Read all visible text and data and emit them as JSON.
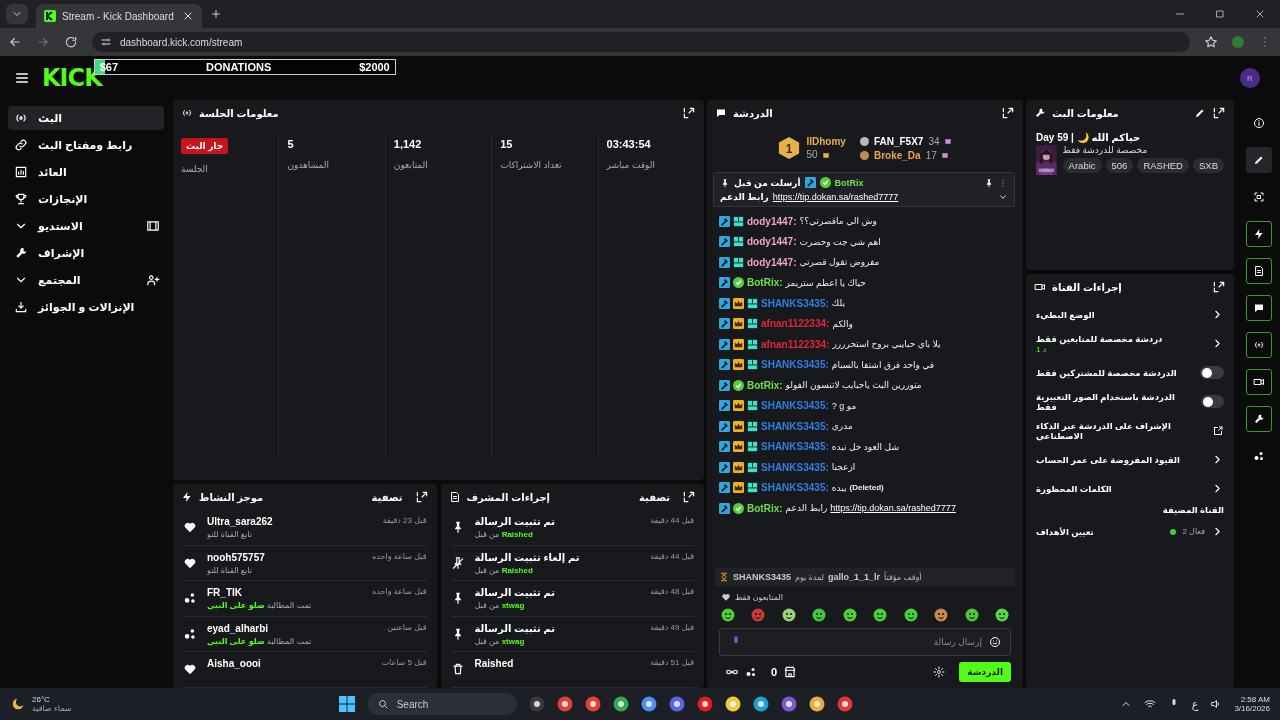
{
  "browser": {
    "tab_title": "Stream - Kick Dashboard",
    "url": "dashboard.kick.com/stream"
  },
  "header": {
    "logo": "KICK",
    "donation": {
      "current": "$67",
      "label": "DONATIONS",
      "goal": "$2000",
      "level": 0.034
    },
    "avatar": "R"
  },
  "sidebar": {
    "items": [
      {
        "kind": "link",
        "label": "البث",
        "selected": true
      },
      {
        "kind": "link",
        "label": "رابط ومفتاح البث",
        "selected": false
      },
      {
        "kind": "link",
        "label": "العائد",
        "selected": false
      },
      {
        "kind": "link",
        "label": "الإنجازات",
        "selected": false
      },
      {
        "kind": "group",
        "label": "الاستديو",
        "selected": false
      },
      {
        "kind": "link",
        "label": "الإشراف",
        "selected": false
      },
      {
        "kind": "group",
        "label": "المجتمع",
        "selected": false
      },
      {
        "kind": "link",
        "label": "الإنزالات و الجوائز",
        "selected": false
      }
    ]
  },
  "session": {
    "title": "معلومات الجلسة",
    "stats": [
      {
        "value": "03:43:54",
        "label": "الوقت مباشر"
      },
      {
        "value": "15",
        "label": "تعداد الاشتراكات"
      },
      {
        "value": "1,142",
        "label": "المتابعون"
      },
      {
        "value": "5",
        "label": "المشاهدون"
      }
    ],
    "status": "جار البث",
    "status_label": "الجلسة"
  },
  "activity": {
    "title": "موجز النشاط",
    "filter": "تصفية",
    "items": [
      {
        "kind": "follow",
        "user": "Ultra_sara262",
        "detail": "تابع القناة للتو",
        "time": "قبل 23 دقيقة"
      },
      {
        "kind": "follow",
        "user": "nooh575757",
        "detail": "تابع القناة للتو",
        "time": "قبل ساعة واحده"
      },
      {
        "kind": "redeem",
        "user": "FR_TIK",
        "detail": "تمت المطالبة **صلو على النبي**",
        "time": "قبل ساعة واحده"
      },
      {
        "kind": "redeem",
        "user": "eyad_alharbi",
        "detail": "تمت المطالبة **صلو على النبي**",
        "time": "قبل ساعتين"
      },
      {
        "kind": "follow",
        "user": "Aisha_oooi",
        "time": "قبل 5 ساعات"
      }
    ]
  },
  "mod_actions": {
    "title": "إجراءات المشرف",
    "filter": "تصفية",
    "items": [
      {
        "kind": "pin",
        "action": "تم تثبيت الرسالة",
        "by": "من قبل",
        "user": "Raished",
        "time": "قبل 44 دقيقة"
      },
      {
        "kind": "unpin",
        "action": "تم إلغاء تثبيت الرسالة",
        "by": "من قبل",
        "user": "Raished",
        "time": "قبل 44 دقيقة"
      },
      {
        "kind": "pin",
        "action": "تم تثبيت الرسالة",
        "by": "من قبل",
        "user": "xtwag",
        "time": "قبل 48 دقيقة"
      },
      {
        "kind": "pin",
        "action": "تم تثبيت الرسالة",
        "by": "من قبل",
        "user": "xtwag",
        "time": "قبل 49 دقيقة"
      },
      {
        "kind": "delete",
        "action": "Raished",
        "time": "قبل 51 دقيقة"
      }
    ]
  },
  "chat": {
    "title": "الدردشة",
    "leaderboard": {
      "others": [
        {
          "user": "FAN_F5X7",
          "count": "34",
          "color": "#ffffff"
        },
        {
          "user": "Broke_Da",
          "count": "17",
          "color": "#e8a84a"
        }
      ],
      "top": {
        "rank": "1",
        "user": "IIDhomy",
        "count": "50",
        "color": "#e8b04a"
      }
    },
    "pinned": {
      "label": "أرسلت من قبل",
      "user": "BotRix",
      "text": "رابط الدعم",
      "link": "https://tip.dokan.sa/rashed7777"
    },
    "messages": [
      {
        "user": "dody1447:",
        "color": "#f0a6c6",
        "moderator": true,
        "subscriber": false,
        "og": true,
        "verified": false,
        "text": "وش الي ماقصرتي؟؟"
      },
      {
        "user": "dody1447:",
        "color": "#f0a6c6",
        "moderator": true,
        "subscriber": false,
        "og": true,
        "verified": false,
        "text": "اهم شي جت وحضرت"
      },
      {
        "user": "dody1447:",
        "color": "#f0a6c6",
        "moderator": true,
        "subscriber": false,
        "og": true,
        "verified": false,
        "text": "مفروض تقول قصرتي"
      },
      {
        "user": "BotRix:",
        "color": "#6fe04a",
        "moderator": true,
        "subscriber": false,
        "og": false,
        "verified": true,
        "text": "حياك يا اعظم ستريمر"
      },
      {
        "user": "SHANKS3435:",
        "color": "#2f7fe6",
        "moderator": true,
        "subscriber": true,
        "og": true,
        "verified": false,
        "text": "يلك"
      },
      {
        "user": "afnan1122334:",
        "color": "#e0263c",
        "moderator": true,
        "subscriber": true,
        "og": true,
        "verified": false,
        "text": "والكم"
      },
      {
        "user": "afnan1122334:",
        "color": "#e0263c",
        "moderator": true,
        "subscriber": true,
        "og": true,
        "verified": false,
        "text": "يلا باي حبايبي بروح استحرررر"
      },
      {
        "user": "SHANKS3435:",
        "color": "#2f7fe6",
        "moderator": true,
        "subscriber": true,
        "og": true,
        "verified": false,
        "text": "في واحد فرق اشتفا بالسبام"
      },
      {
        "user": "BotRix:",
        "color": "#6fe04a",
        "moderator": true,
        "subscriber": false,
        "og": false,
        "verified": true,
        "text": "متوررين البث ياحبايب لاتنسون الفولو"
      },
      {
        "user": "SHANKS3435:",
        "color": "#2f7fe6",
        "moderator": true,
        "subscriber": true,
        "og": true,
        "verified": false,
        "text": "? g مو"
      },
      {
        "user": "SHANKS3435:",
        "color": "#2f7fe6",
        "moderator": true,
        "subscriber": true,
        "og": true,
        "verified": false,
        "text": "مدري"
      },
      {
        "user": "SHANKS3435:",
        "color": "#2f7fe6",
        "moderator": true,
        "subscriber": true,
        "og": true,
        "verified": false,
        "text": "شل العود حل تبده"
      },
      {
        "user": "SHANKS3435:",
        "color": "#2f7fe6",
        "moderator": true,
        "subscriber": true,
        "og": true,
        "verified": false,
        "text": "ازعجنا"
      },
      {
        "user": "SHANKS3435:",
        "color": "#2f7fe6",
        "moderator": true,
        "subscriber": true,
        "og": true,
        "verified": false,
        "text": "يبده",
        "deleted": "(Deleted)"
      },
      {
        "user": "BotRix:",
        "color": "#6fe04a",
        "moderator": true,
        "subscriber": false,
        "og": false,
        "verified": true,
        "text": "رابط الدعم",
        "link": "https://tip.dokan.sa/rashed7777"
      }
    ],
    "event": {
      "actor": "SHANKS3435",
      "duration": "لمدة يوم",
      "target": "gallo_1_1_lr",
      "action": "أوقف مؤقتاً"
    },
    "mode": "المتابعون فقط",
    "placeholder": "إرسال رسالة",
    "points": "0",
    "send": "الدردشة"
  },
  "stream_info": {
    "title": "معلومات البث",
    "stream_title": "حياكم الله 🌙 | 59 Day",
    "category": "مخصصة للدردشة فقط",
    "tags": [
      "SXB",
      "RASHED",
      "506",
      "Arabic"
    ]
  },
  "channel_actions": {
    "title": "إجراءات القناة",
    "items": [
      {
        "kind": "link",
        "label": "الوضع البطيء"
      },
      {
        "kind": "link",
        "label": "دردشة مخصصة للمتابعين فقط",
        "sub": "1 د"
      },
      {
        "kind": "toggle",
        "label": "الدردشة مخصصة للمشتركين فقط",
        "on": false
      },
      {
        "kind": "toggle",
        "label": "الدردشة باستخدام الصور التعبيرية فقط",
        "on": false
      },
      {
        "kind": "external",
        "label": "الإشراف على الدردشة عبر الذكاء الاصطناعي"
      },
      {
        "kind": "link",
        "label": "القيود المفروضة على عمر الحساب"
      },
      {
        "kind": "link",
        "label": "الكلمات المحظورة"
      },
      {
        "kind": "section",
        "label": "القناة المضيفة"
      },
      {
        "kind": "goal",
        "label": "تعيين الأهداف",
        "status": "فعال 2",
        "color": "#3ecf3e"
      }
    ]
  },
  "toolbar": [
    {
      "selected": false,
      "highlighted": false
    },
    {
      "selected": true,
      "highlighted": false
    },
    {
      "selected": false,
      "highlighted": false
    },
    {
      "selected": false,
      "highlighted": true
    },
    {
      "selected": false,
      "highlighted": true
    },
    {
      "selected": false,
      "highlighted": true
    },
    {
      "selected": false,
      "highlighted": true
    },
    {
      "selected": false,
      "highlighted": true
    },
    {
      "selected": false,
      "highlighted": true
    },
    {
      "selected": false,
      "highlighted": false
    }
  ],
  "taskbar": {
    "temperature": "26°C",
    "weather": "سماء صافية",
    "search": "Search",
    "language": "ع",
    "time": "2:58 AM",
    "date": "3/16/2026"
  }
}
